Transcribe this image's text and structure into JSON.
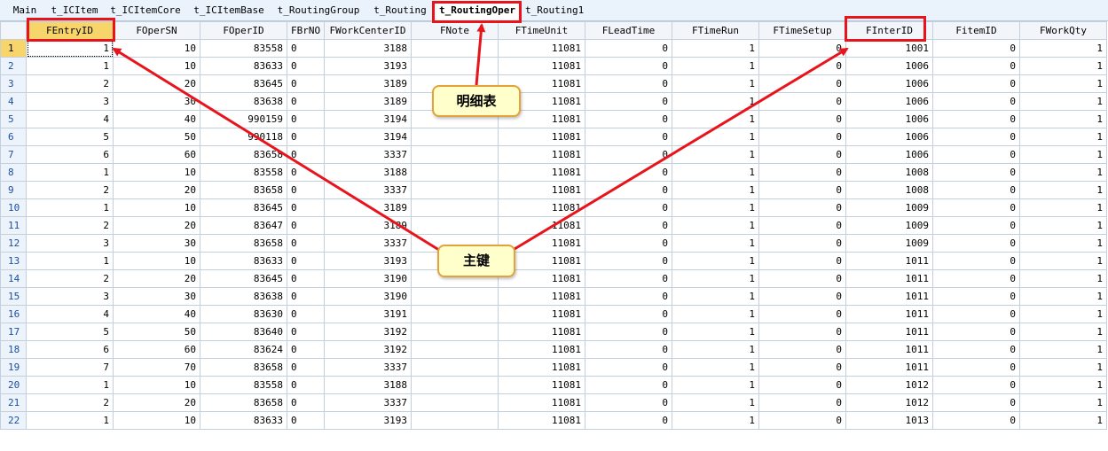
{
  "tabs": [
    {
      "label": "Main",
      "active": false
    },
    {
      "label": "t_ICItem",
      "active": false
    },
    {
      "label": "t_ICItemCore",
      "active": false
    },
    {
      "label": "t_ICItemBase",
      "active": false
    },
    {
      "label": "t_RoutingGroup",
      "active": false
    },
    {
      "label": "t_Routing",
      "active": false
    },
    {
      "label": "t_RoutingOper",
      "active": true
    },
    {
      "label": "t_Routing1",
      "active": false
    }
  ],
  "columns": [
    "FEntryID",
    "FOperSN",
    "FOperID",
    "FBrNO",
    "FWorkCenterID",
    "FNote",
    "FTimeUnit",
    "FLeadTime",
    "FTimeRun",
    "FTimeSetup",
    "FInterID",
    "FitemID",
    "FWorkQty"
  ],
  "rows": [
    [
      "1",
      "10",
      "83558",
      "0",
      "3188",
      "",
      "11081",
      "0",
      "1",
      "0",
      "1001",
      "0",
      "1"
    ],
    [
      "1",
      "10",
      "83633",
      "0",
      "3193",
      "",
      "11081",
      "0",
      "1",
      "0",
      "1006",
      "0",
      "1"
    ],
    [
      "2",
      "20",
      "83645",
      "0",
      "3189",
      "",
      "11081",
      "0",
      "1",
      "0",
      "1006",
      "0",
      "1"
    ],
    [
      "3",
      "30",
      "83638",
      "0",
      "3189",
      "",
      "11081",
      "0",
      "1",
      "0",
      "1006",
      "0",
      "1"
    ],
    [
      "4",
      "40",
      "990159",
      "0",
      "3194",
      "",
      "11081",
      "0",
      "1",
      "0",
      "1006",
      "0",
      "1"
    ],
    [
      "5",
      "50",
      "990118",
      "0",
      "3194",
      "",
      "11081",
      "0",
      "1",
      "0",
      "1006",
      "0",
      "1"
    ],
    [
      "6",
      "60",
      "83658",
      "0",
      "3337",
      "",
      "11081",
      "0",
      "1",
      "0",
      "1006",
      "0",
      "1"
    ],
    [
      "1",
      "10",
      "83558",
      "0",
      "3188",
      "",
      "11081",
      "0",
      "1",
      "0",
      "1008",
      "0",
      "1"
    ],
    [
      "2",
      "20",
      "83658",
      "0",
      "3337",
      "",
      "11081",
      "0",
      "1",
      "0",
      "1008",
      "0",
      "1"
    ],
    [
      "1",
      "10",
      "83645",
      "0",
      "3189",
      "",
      "11081",
      "0",
      "1",
      "0",
      "1009",
      "0",
      "1"
    ],
    [
      "2",
      "20",
      "83647",
      "0",
      "3189",
      "",
      "11081",
      "0",
      "1",
      "0",
      "1009",
      "0",
      "1"
    ],
    [
      "3",
      "30",
      "83658",
      "0",
      "3337",
      "",
      "11081",
      "0",
      "1",
      "0",
      "1009",
      "0",
      "1"
    ],
    [
      "1",
      "10",
      "83633",
      "0",
      "3193",
      "",
      "11081",
      "0",
      "1",
      "0",
      "1011",
      "0",
      "1"
    ],
    [
      "2",
      "20",
      "83645",
      "0",
      "3190",
      "",
      "11081",
      "0",
      "1",
      "0",
      "1011",
      "0",
      "1"
    ],
    [
      "3",
      "30",
      "83638",
      "0",
      "3190",
      "",
      "11081",
      "0",
      "1",
      "0",
      "1011",
      "0",
      "1"
    ],
    [
      "4",
      "40",
      "83630",
      "0",
      "3191",
      "",
      "11081",
      "0",
      "1",
      "0",
      "1011",
      "0",
      "1"
    ],
    [
      "5",
      "50",
      "83640",
      "0",
      "3192",
      "",
      "11081",
      "0",
      "1",
      "0",
      "1011",
      "0",
      "1"
    ],
    [
      "6",
      "60",
      "83624",
      "0",
      "3192",
      "",
      "11081",
      "0",
      "1",
      "0",
      "1011",
      "0",
      "1"
    ],
    [
      "7",
      "70",
      "83658",
      "0",
      "3337",
      "",
      "11081",
      "0",
      "1",
      "0",
      "1011",
      "0",
      "1"
    ],
    [
      "1",
      "10",
      "83558",
      "0",
      "3188",
      "",
      "11081",
      "0",
      "1",
      "0",
      "1012",
      "0",
      "1"
    ],
    [
      "2",
      "20",
      "83658",
      "0",
      "3337",
      "",
      "11081",
      "0",
      "1",
      "0",
      "1012",
      "0",
      "1"
    ],
    [
      "1",
      "10",
      "83633",
      "0",
      "3193",
      "",
      "11081",
      "0",
      "1",
      "0",
      "1013",
      "0",
      "1"
    ]
  ],
  "callouts": {
    "detail_table": "明细表",
    "primary_key": "主键"
  },
  "colors": {
    "highlight": "#f8d56a",
    "annotation_red": "#e8141c",
    "callout_fill": "#ffffcc",
    "callout_border": "#e4a33a"
  }
}
